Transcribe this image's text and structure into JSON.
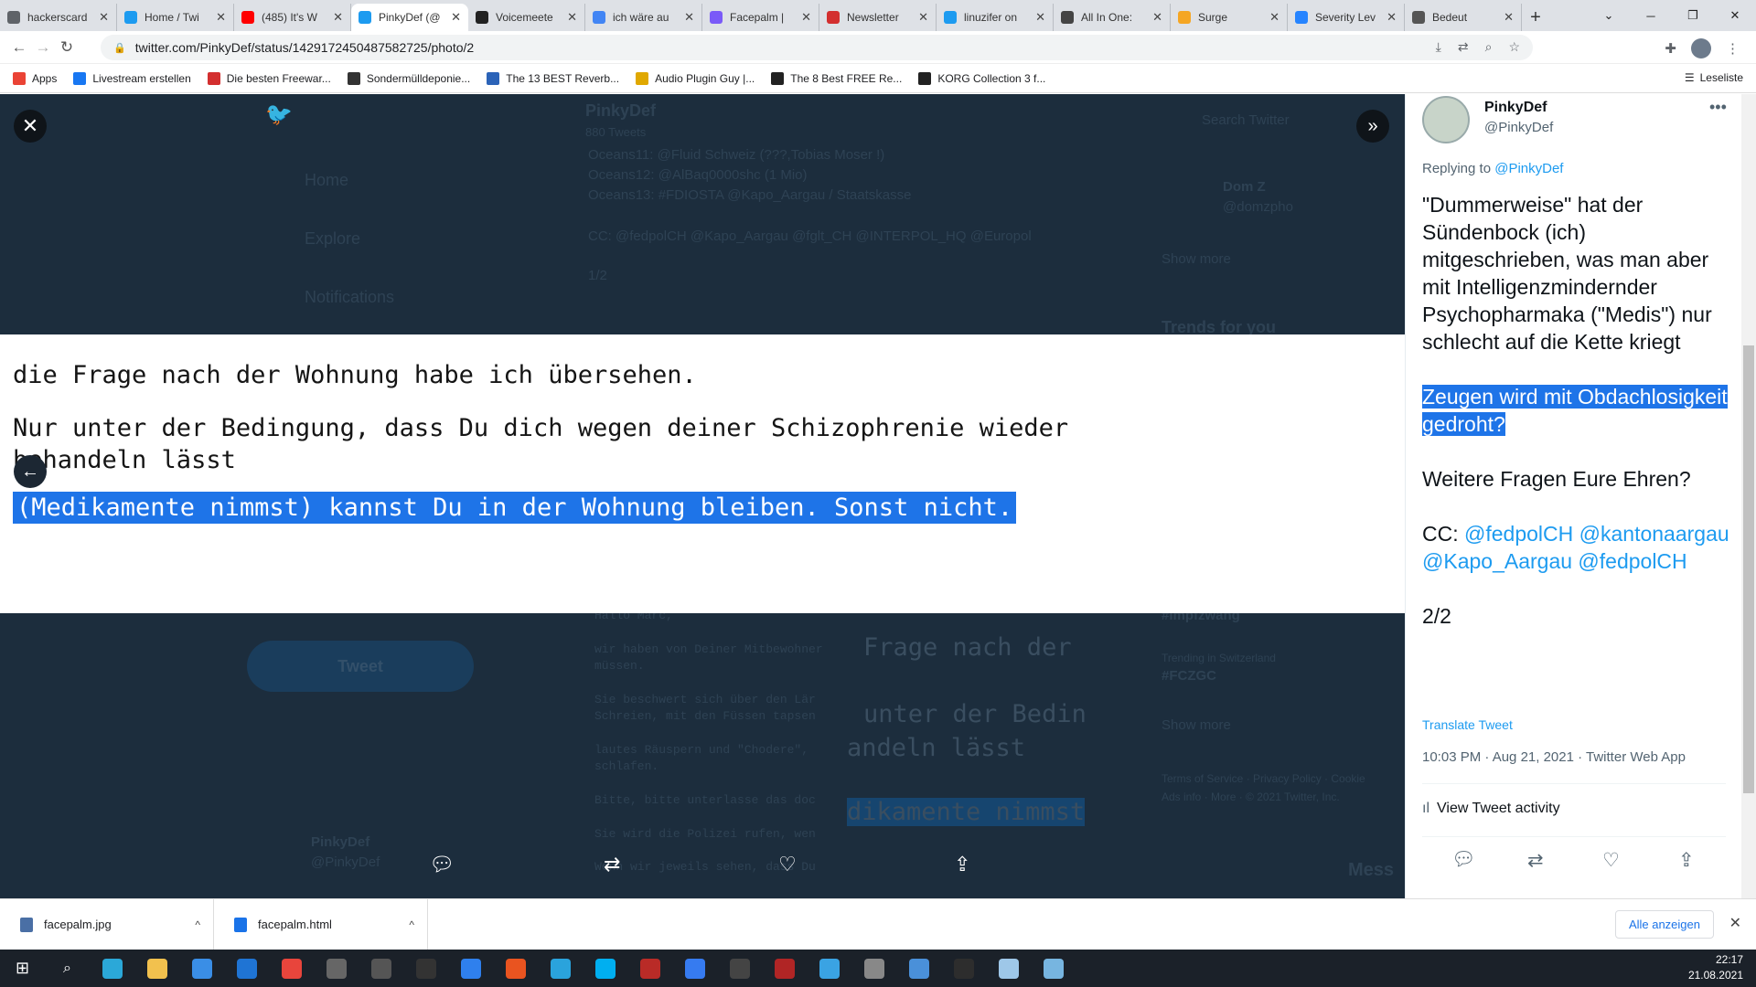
{
  "tabs": [
    {
      "title": "hackerscard",
      "color": "#5f6368"
    },
    {
      "title": "Home / Twi",
      "color": "#1d9bf0"
    },
    {
      "title": "(485) It's W",
      "color": "#ff0000"
    },
    {
      "title": "PinkyDef (@",
      "color": "#1d9bf0"
    },
    {
      "title": "Voicemeete",
      "color": "#222222"
    },
    {
      "title": "ich wäre au",
      "color": "#4285f4"
    },
    {
      "title": "Facepalm |",
      "color": "#7a5af8"
    },
    {
      "title": "Newsletter",
      "color": "#d32f2f"
    },
    {
      "title": "linuzifer on",
      "color": "#1d9bf0"
    },
    {
      "title": "All In One:",
      "color": "#444444"
    },
    {
      "title": "Surge",
      "color": "#f5a623"
    },
    {
      "title": "Severity Lev",
      "color": "#2684ff"
    },
    {
      "title": "Bedeut",
      "color": "#555555"
    }
  ],
  "active_tab": 3,
  "url": "twitter.com/PinkyDef/status/1429172450487582725/photo/2",
  "bookmarks": [
    {
      "label": "Apps",
      "color": "#ea4335"
    },
    {
      "label": "Livestream erstellen",
      "color": "#1877f2"
    },
    {
      "label": "Die besten Freewar...",
      "color": "#d32f2f"
    },
    {
      "label": "Sondermülldeponie...",
      "color": "#333333"
    },
    {
      "label": "The 13 BEST Reverb...",
      "color": "#2b63b8"
    },
    {
      "label": "Audio Plugin Guy |...",
      "color": "#e0a800"
    },
    {
      "label": "The 8 Best FREE Re...",
      "color": "#222222"
    },
    {
      "label": "KORG Collection 3 f...",
      "color": "#222222"
    }
  ],
  "leseliste": "Leseliste",
  "background": {
    "nav": [
      "Home",
      "Explore",
      "Notifications"
    ],
    "profile_title": "PinkyDef",
    "profile_sub": "880 Tweets",
    "tweet_lines": [
      "Oceans11: @Fluid Schweiz (???,Tobias Moser !)",
      "Oceans12: @AlBaq0000shc (1 Mio)",
      "Oceans13: #FDIOSTA @Kapo_Aargau / Staatskasse",
      "CC: @fedpolCH @Kapo_Aargau @fglt_CH @INTERPOL_HQ @Europol",
      "1/2"
    ],
    "search": "Search Twitter",
    "who": "Dom Z",
    "who_handle": "@domzpho",
    "trends": "Trends for you",
    "show_more": "Show more",
    "trend1": "#impfzwang",
    "trend2_label": "Trending in Switzerland",
    "trend2": "#FCZGC",
    "tweet_btn": "Tweet",
    "footer": "Terms of Service · Privacy Policy · Cookie",
    "footer2": "Ads info · More · © 2021 Twitter, Inc.",
    "mono_lines": [
      "Hallo Marc,",
      "wir haben von Deiner Mitbewohner",
      "müssen.",
      "Sie beschwert sich über den Lär",
      "Schreien, mit den Füssen tapsen",
      "lautes Räuspern und \"Chodere\",",
      "schlafen.",
      "Bitte, bitte unterlasse das doc",
      "Sie wird die Polizei rufen, wen",
      "Wenn wir jeweils sehen, dass Du"
    ],
    "zoom_lines": [
      "Frage nach der",
      "unter der Bedin",
      "andeln lässt",
      "dikamente nimmst"
    ],
    "bottom_name": "PinkyDef",
    "bottom_handle": "@PinkyDef",
    "messages": "Mess"
  },
  "image_text": {
    "line1": "die Frage nach der Wohnung habe ich übersehen.",
    "line2": "Nur unter der Bedingung, dass Du dich wegen deiner Schizophrenie wieder",
    "line3": "behandeln lässt",
    "line4": "(Medikamente nimmst) kannst Du in der Wohnung bleiben. Sonst nicht."
  },
  "tweet": {
    "name": "PinkyDef",
    "handle": "@PinkyDef",
    "replying_prefix": "Replying to",
    "replying_to": "@PinkyDef",
    "p1": "\"Dummerweise\" hat der Sündenbock (ich) mitgeschrieben, was man aber mit Intelligenzmindernder Psychopharmaka (\"Medis\") nur schlecht auf die Kette kriegt",
    "p2": "Zeugen wird mit Obdachlosigkeit gedroht?",
    "p3": "Weitere Fragen Eure Ehren?",
    "cc_label": "CC:",
    "cc_mentions": "@fedpolCH @kantonaargau @Kapo_Aargau @fedpolCH",
    "count": "2/2",
    "translate": "Translate Tweet",
    "meta": "10:03 PM · Aug 21, 2021 · Twitter Web App",
    "activity": "View Tweet activity"
  },
  "downloads": [
    {
      "name": "facepalm.jpg",
      "color": "#4a6fa5"
    },
    {
      "name": "facepalm.html",
      "color": "#1a73e8"
    }
  ],
  "alle_anzeigen": "Alle anzeigen",
  "clock": {
    "time": "22:17",
    "date": "21.08.2021"
  },
  "taskbar_icons": [
    {
      "name": "edge",
      "color": "#2ba8d8"
    },
    {
      "name": "explorer",
      "color": "#f2c14e"
    },
    {
      "name": "store",
      "color": "#3a8ee6"
    },
    {
      "name": "mail",
      "color": "#1f74d4"
    },
    {
      "name": "chrome",
      "color": "#e8453c"
    },
    {
      "name": "app1",
      "color": "#666666"
    },
    {
      "name": "app2",
      "color": "#555555"
    },
    {
      "name": "live",
      "color": "#333333"
    },
    {
      "name": "app3",
      "color": "#2f80ed"
    },
    {
      "name": "ubuntu",
      "color": "#e95420"
    },
    {
      "name": "telegram",
      "color": "#2aa3dc"
    },
    {
      "name": "skype",
      "color": "#00aff0"
    },
    {
      "name": "app4",
      "color": "#b92b27"
    },
    {
      "name": "kali",
      "color": "#367bf0"
    },
    {
      "name": "app5",
      "color": "#444444"
    },
    {
      "name": "voicemeeter",
      "color": "#b02525"
    },
    {
      "name": "app6",
      "color": "#3aa3e3"
    },
    {
      "name": "app7",
      "color": "#888888"
    },
    {
      "name": "app8",
      "color": "#4a90d9"
    },
    {
      "name": "terminal",
      "color": "#2d2d2d"
    },
    {
      "name": "notepad",
      "color": "#9ec7e8"
    },
    {
      "name": "app9",
      "color": "#77b5e0"
    }
  ]
}
